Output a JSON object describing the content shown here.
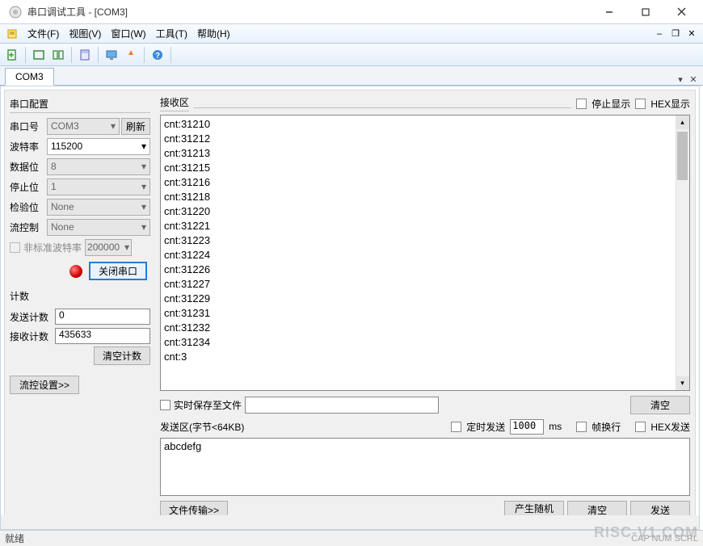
{
  "window": {
    "title": "串口调试工具 - [COM3]"
  },
  "menu": {
    "file": "文件(F)",
    "view": "视图(V)",
    "window": "窗口(W)",
    "tool": "工具(T)",
    "help": "帮助(H)"
  },
  "tab": {
    "label": "COM3"
  },
  "config": {
    "title": "串口配置",
    "port_label": "串口号",
    "port_value": "COM3",
    "refresh": "刷新",
    "baud_label": "波特率",
    "baud_value": "115200",
    "databits_label": "数据位",
    "databits_value": "8",
    "stopbits_label": "停止位",
    "stopbits_value": "1",
    "parity_label": "检验位",
    "parity_value": "None",
    "flow_label": "流控制",
    "flow_value": "None",
    "nonstd_label": "非标准波特率",
    "nonstd_value": "200000",
    "close_btn": "关闭串口"
  },
  "count": {
    "title": "计数",
    "send_label": "发送计数",
    "send_value": "0",
    "recv_label": "接收计数",
    "recv_value": "435633",
    "clear_btn": "清空计数"
  },
  "flowset_btn": "流控设置>>",
  "recv": {
    "title": "接收区",
    "stop_disp": "停止显示",
    "hex_disp": "HEX显示",
    "lines": "cnt:31210\ncnt:31212\ncnt:31213\ncnt:31215\ncnt:31216\ncnt:31218\ncnt:31220\ncnt:31221\ncnt:31223\ncnt:31224\ncnt:31226\ncnt:31227\ncnt:31229\ncnt:31231\ncnt:31232\ncnt:31234\ncnt:3"
  },
  "save": {
    "label": "实时保存至文件",
    "clear_btn": "清空"
  },
  "send": {
    "title": "发送区(字节<64KB)",
    "timed_label": "定时发送",
    "interval": "1000",
    "ms": "ms",
    "wrap_label": "帧换行",
    "hex_label": "HEX发送",
    "content": "abcdefg",
    "file_btn": "文件传输>>",
    "random_btn": "产生随机数",
    "clear_btn": "清空",
    "send_btn": "发送"
  },
  "status": {
    "ready": "就绪",
    "indicators": "CAP  NUM  SCRL"
  },
  "watermark": "RISC-V1.COM"
}
